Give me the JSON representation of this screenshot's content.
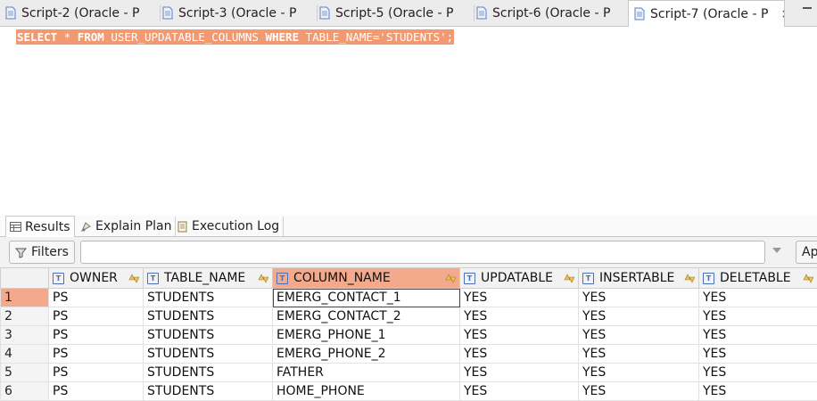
{
  "tabs": [
    {
      "label": "Script-2 (Oracle - P",
      "active": false
    },
    {
      "label": "Script-3 (Oracle - P",
      "active": false
    },
    {
      "label": "Script-5 (Oracle - P",
      "active": false
    },
    {
      "label": "Script-6 (Oracle - P",
      "active": false
    },
    {
      "label": "Script-7 (Oracle - P",
      "active": true
    }
  ],
  "editor": {
    "sql_parts": [
      "SELECT",
      " * ",
      "FROM",
      " USER_UPDATABLE_COLUMNS ",
      "WHERE",
      " TABLE_NAME='STUDENTS';"
    ]
  },
  "result_tabs": [
    "Results",
    "Explain Plan",
    "Execution Log"
  ],
  "filter": {
    "button_label": "Filters",
    "placeholder": "",
    "apply_label": "Ap"
  },
  "grid": {
    "columns": [
      "OWNER",
      "TABLE_NAME",
      "COLUMN_NAME",
      "UPDATABLE",
      "INSERTABLE",
      "DELETABLE"
    ],
    "selected_column": "COLUMN_NAME",
    "rows": [
      {
        "n": "1",
        "cells": [
          "PS",
          "STUDENTS",
          "EMERG_CONTACT_1",
          "YES",
          "YES",
          "YES"
        ]
      },
      {
        "n": "2",
        "cells": [
          "PS",
          "STUDENTS",
          "EMERG_CONTACT_2",
          "YES",
          "YES",
          "YES"
        ]
      },
      {
        "n": "3",
        "cells": [
          "PS",
          "STUDENTS",
          "EMERG_PHONE_1",
          "YES",
          "YES",
          "YES"
        ]
      },
      {
        "n": "4",
        "cells": [
          "PS",
          "STUDENTS",
          "EMERG_PHONE_2",
          "YES",
          "YES",
          "YES"
        ]
      },
      {
        "n": "5",
        "cells": [
          "PS",
          "STUDENTS",
          "FATHER",
          "YES",
          "YES",
          "YES"
        ]
      },
      {
        "n": "6",
        "cells": [
          "PS",
          "STUDENTS",
          "HOME_PHONE",
          "YES",
          "YES",
          "YES"
        ]
      }
    ]
  },
  "colors": {
    "selection": "#f19a72",
    "header_selected": "#f3a98b"
  }
}
